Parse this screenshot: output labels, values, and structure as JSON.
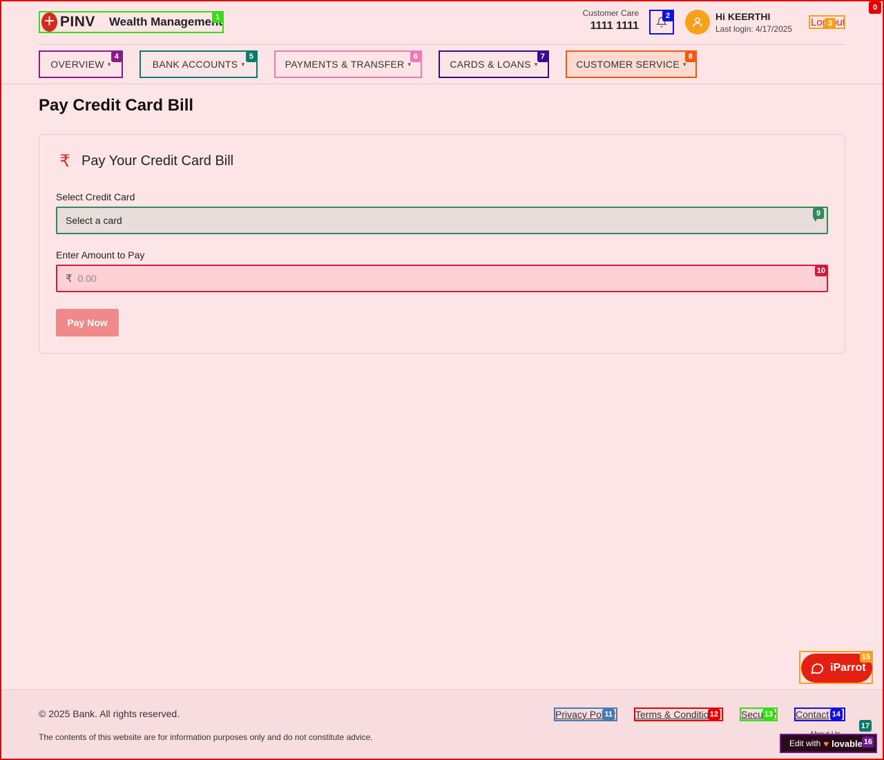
{
  "colors": {
    "brand_red": "#d42b1e",
    "page_bg": "#fde4e6",
    "pay_button": "#f08a8a",
    "avatar_bg": "#f7a21b"
  },
  "overlay_badges": {
    "page": "0",
    "logo": "1",
    "bell": "2",
    "logout": "3",
    "overview": "4",
    "bank_accounts": "5",
    "payments": "6",
    "cards_loans": "7",
    "customer_service": "8",
    "select": "9",
    "amount": "10",
    "privacy": "11",
    "terms": "12",
    "security": "13",
    "contact": "14",
    "chat": "15",
    "lovable": "16",
    "extra": "17"
  },
  "header": {
    "logo_symbol": "+",
    "logo_text": "PINV",
    "logo_subtitle": "Wealth Management",
    "customer_care_label": "Customer Care",
    "customer_care_number": "1111 1111",
    "bell_icon": "bell-icon",
    "avatar_icon": "user-icon",
    "greeting": "Hi KEERTHI",
    "last_login_label": "Last login:",
    "last_login_date": "4/17/2025",
    "logout_label": "Log out"
  },
  "nav": {
    "tabs": [
      {
        "label": "OVERVIEW"
      },
      {
        "label": "BANK ACCOUNTS"
      },
      {
        "label": "PAYMENTS & TRANSFER"
      },
      {
        "label": "CARDS & LOANS"
      },
      {
        "label": "CUSTOMER SERVICE"
      }
    ]
  },
  "main": {
    "page_title": "Pay Credit Card Bill",
    "card_icon": "rupee-icon",
    "card_title": "Pay Your Credit Card Bill",
    "select_label": "Select Credit Card",
    "select_value": "Select a card",
    "amount_label": "Enter Amount to Pay",
    "currency_symbol": "₹",
    "amount_placeholder": "0.00",
    "pay_button": "Pay Now"
  },
  "chat": {
    "label": "iParrot",
    "icon": "chat-bubble-icon"
  },
  "footer": {
    "copyright": "© 2025 Bank. All rights reserved.",
    "disclaimer": "The contents of this website are for information purposes only and do not constitute advice.",
    "links": [
      "Privacy Policy",
      "Terms & Conditions",
      "Security",
      "Contact",
      "About Us"
    ],
    "edit_with": "Edit with",
    "edit_brand": "lovable"
  }
}
